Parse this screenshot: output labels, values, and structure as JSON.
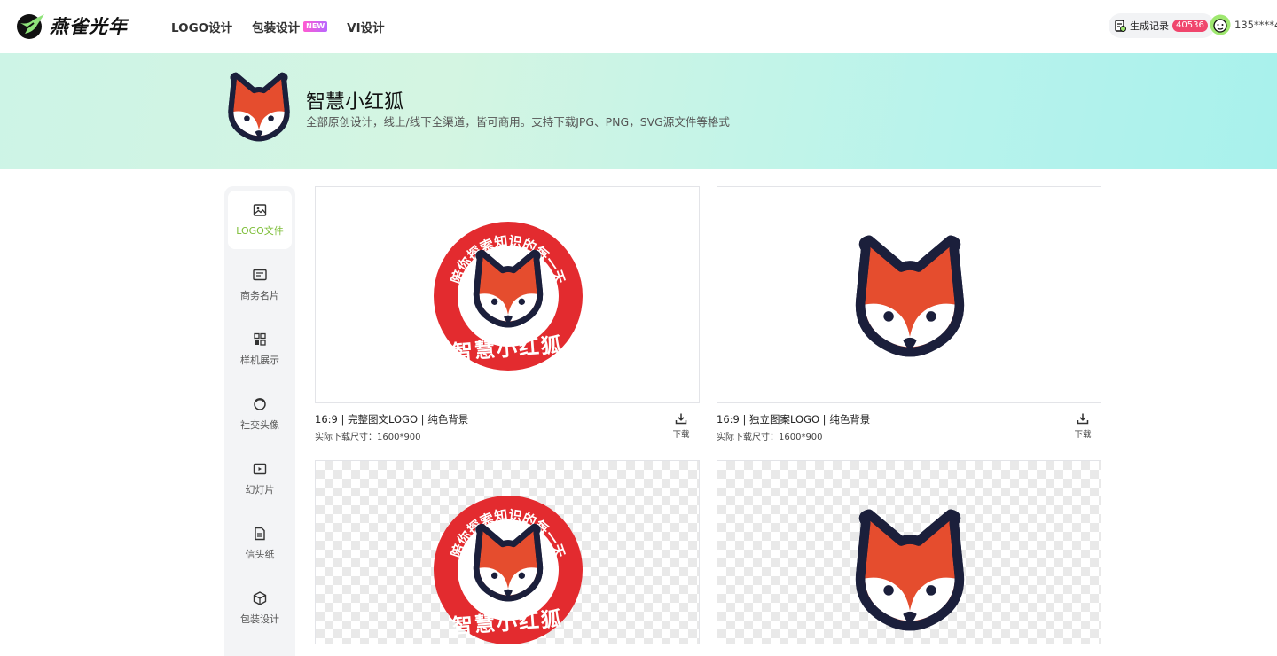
{
  "header": {
    "brand": "燕雀光年",
    "nav": [
      {
        "label": "LOGO设计"
      },
      {
        "label": "包装设计",
        "badge": "NEW"
      },
      {
        "label": "VI设计"
      }
    ],
    "records": {
      "label": "生成记录",
      "count": "40536"
    },
    "user": {
      "name": "135****4"
    }
  },
  "hero": {
    "title": "智慧小红狐",
    "subtitle": "全部原创设计，线上/线下全渠道，皆可商用。支持下载JPG、PNG，SVG源文件等格式"
  },
  "sidebar": {
    "items": [
      {
        "label": "LOGO文件",
        "icon": "image-icon",
        "active": true
      },
      {
        "label": "商务名片",
        "icon": "business-card-icon"
      },
      {
        "label": "样机展示",
        "icon": "mockup-grid-icon"
      },
      {
        "label": "社交头像",
        "icon": "social-avatar-icon"
      },
      {
        "label": "幻灯片",
        "icon": "slides-icon"
      },
      {
        "label": "信头纸",
        "icon": "letterhead-icon"
      },
      {
        "label": "包装设计",
        "icon": "package-box-icon"
      }
    ]
  },
  "logo_text": {
    "ring": "陪你探索知识的每一天",
    "name": "智慧小红狐"
  },
  "cards": [
    {
      "title": "16:9 | 完整图文LOGO | 纯色背景",
      "size": "实际下载尺寸：1600*900",
      "download": "下载"
    },
    {
      "title": "16:9 | 独立图案LOGO | 纯色背景",
      "size": "实际下载尺寸：1600*900",
      "download": "下载"
    }
  ],
  "colors": {
    "fox_orange": "#e54d2e",
    "fox_outline": "#1b1f3b",
    "badge_red": "#e32b2f",
    "accent_green": "#7cbd36",
    "count_badge": "#f0466d"
  }
}
